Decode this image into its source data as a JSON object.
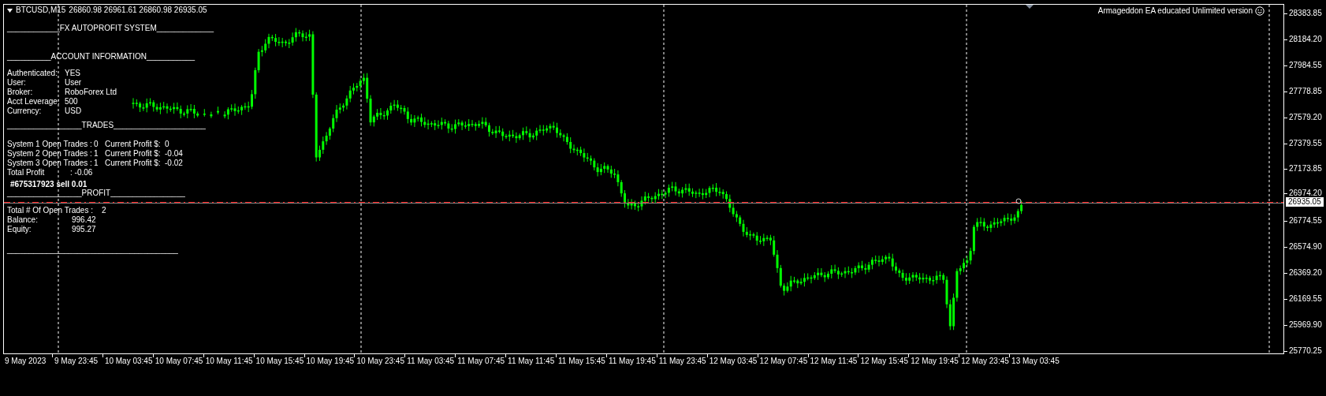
{
  "chart": {
    "symbol": "BTCUSD,M15",
    "ohlc": "26860.98 26961.61 26860.98 26935.05",
    "expert": "Armageddon EA educated Unlimited version",
    "trade_label": "#675317923 sell 0.01",
    "current_price": "26935.05",
    "price_axis": [
      "28383.85",
      "28184.20",
      "27984.55",
      "27778.85",
      "27579.20",
      "27379.55",
      "27173.85",
      "26974.20",
      "26774.55",
      "26574.90",
      "26369.20",
      "26169.55",
      "25969.90",
      "25770.25"
    ],
    "time_axis": [
      "9 May 2023",
      "9 May 23:45",
      "10 May 03:45",
      "10 May 07:45",
      "10 May 11:45",
      "10 May 15:45",
      "10 May 19:45",
      "10 May 23:45",
      "11 May 03:45",
      "11 May 07:45",
      "11 May 11:45",
      "11 May 15:45",
      "11 May 19:45",
      "11 May 23:45",
      "12 May 03:45",
      "12 May 07:45",
      "12 May 11:45",
      "12 May 15:45",
      "12 May 19:45",
      "12 May 23:45",
      "13 May 03:45"
    ]
  },
  "panel": {
    "title": "____________FX AUTOPROFIT SYSTEM_____________",
    "account_heading": "__________ACCOUNT INFORMATION___________",
    "account": [
      {
        "label": "Authenticated:",
        "value": "YES"
      },
      {
        "label": "User:",
        "value": "User"
      },
      {
        "label": "Broker:",
        "value": "RoboForex Ltd"
      },
      {
        "label": "Acct Leverage:",
        "value": "500"
      },
      {
        "label": "Currency:",
        "value": "USD"
      }
    ],
    "trades_heading": "_________________TRADES_____________________",
    "systems": [
      {
        "label": "System 1 Open Trades :",
        "count": "0",
        "profit_label": "Current Profit $:",
        "profit": "0"
      },
      {
        "label": "System 2 Open Trades :",
        "count": "1",
        "profit_label": "Current Profit $:",
        "profit": "-0.04"
      },
      {
        "label": "System 3 Open Trades :",
        "count": "1",
        "profit_label": "Current Profit $:",
        "profit": "-0.02"
      }
    ],
    "total_profit": {
      "label": "Total Profit",
      "value": ":  -0.06"
    },
    "profit_heading": "_________________PROFIT_________________",
    "summary": [
      {
        "label": "Total # Of Open Trades :",
        "value": "2"
      },
      {
        "label": "Balance:",
        "value": "996.42"
      },
      {
        "label": "Equity:",
        "value": "995.27"
      }
    ],
    "footer_rule": "_______________________________________"
  }
}
